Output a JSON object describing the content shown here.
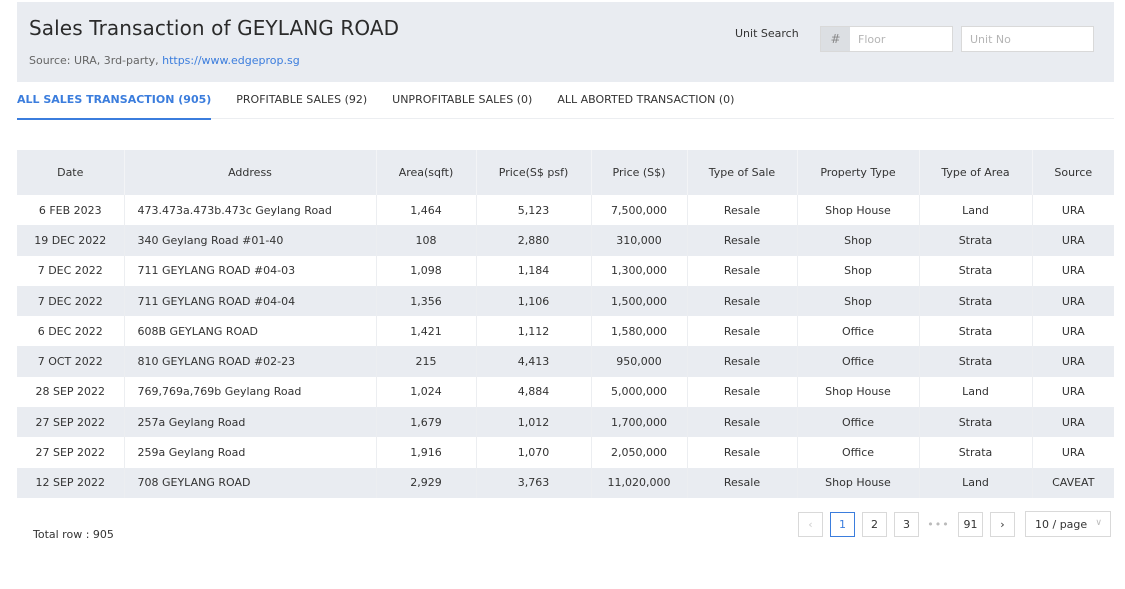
{
  "header": {
    "title": "Sales Transaction of GEYLANG ROAD",
    "source_prefix": "Source: URA, 3rd-party,",
    "source_link": "https://www.edgeprop.sg",
    "unit_search": {
      "label": "Unit Search",
      "floor_addon": "#",
      "floor_placeholder": "Floor",
      "floor_value": "",
      "unit_placeholder": "Unit No",
      "unit_value": ""
    }
  },
  "tabs": [
    {
      "label": "ALL SALES TRANSACTION (905)",
      "active": true
    },
    {
      "label": "PROFITABLE SALES (92)",
      "active": false
    },
    {
      "label": "UNPROFITABLE SALES (0)",
      "active": false
    },
    {
      "label": "ALL ABORTED TRANSACTION (0)",
      "active": false
    }
  ],
  "table": {
    "columns": [
      "Date",
      "Address",
      "Area(sqft)",
      "Price(S$ psf)",
      "Price (S$)",
      "Type of Sale",
      "Property Type",
      "Type of Area",
      "Source"
    ],
    "rows": [
      [
        "6 FEB 2023",
        "473.473a.473b.473c Geylang Road",
        "1,464",
        "5,123",
        "7,500,000",
        "Resale",
        "Shop House",
        "Land",
        "URA"
      ],
      [
        "19 DEC 2022",
        "340 Geylang Road #01-40",
        "108",
        "2,880",
        "310,000",
        "Resale",
        "Shop",
        "Strata",
        "URA"
      ],
      [
        "7 DEC 2022",
        "711 GEYLANG ROAD #04-03",
        "1,098",
        "1,184",
        "1,300,000",
        "Resale",
        "Shop",
        "Strata",
        "URA"
      ],
      [
        "7 DEC 2022",
        "711 GEYLANG ROAD #04-04",
        "1,356",
        "1,106",
        "1,500,000",
        "Resale",
        "Shop",
        "Strata",
        "URA"
      ],
      [
        "6 DEC 2022",
        "608B GEYLANG ROAD",
        "1,421",
        "1,112",
        "1,580,000",
        "Resale",
        "Office",
        "Strata",
        "URA"
      ],
      [
        "7 OCT 2022",
        "810 GEYLANG ROAD #02-23",
        "215",
        "4,413",
        "950,000",
        "Resale",
        "Office",
        "Strata",
        "URA"
      ],
      [
        "28 SEP 2022",
        "769,769a,769b Geylang Road",
        "1,024",
        "4,884",
        "5,000,000",
        "Resale",
        "Shop House",
        "Land",
        "URA"
      ],
      [
        "27 SEP 2022",
        "257a Geylang Road",
        "1,679",
        "1,012",
        "1,700,000",
        "Resale",
        "Office",
        "Strata",
        "URA"
      ],
      [
        "27 SEP 2022",
        "259a Geylang Road",
        "1,916",
        "1,070",
        "2,050,000",
        "Resale",
        "Office",
        "Strata",
        "URA"
      ],
      [
        "12 SEP 2022",
        "708 GEYLANG ROAD",
        "2,929",
        "3,763",
        "11,020,000",
        "Resale",
        "Shop House",
        "Land",
        "CAVEAT"
      ]
    ]
  },
  "footer": {
    "total_row": "Total row : 905",
    "pagination": {
      "prev_icon": "‹",
      "next_icon": "›",
      "pages": [
        "1",
        "2",
        "3"
      ],
      "ellipsis": "•••",
      "last_page": "91",
      "current_page": "1",
      "page_size": "10 / page",
      "page_size_chevron": "∨"
    }
  },
  "colors": {
    "accent": "#3b7ddd",
    "header_bg": "#e9ecf1"
  }
}
